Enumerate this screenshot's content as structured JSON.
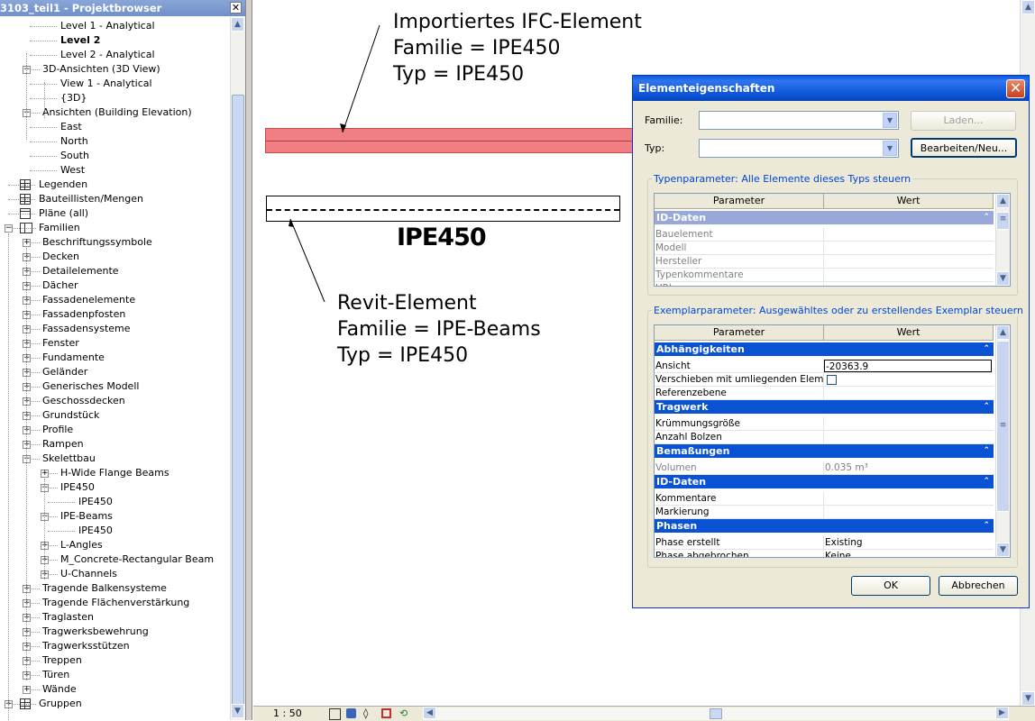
{
  "browser": {
    "title": "3103_teil1 - Projektbrowser",
    "items": [
      {
        "label": "Level 1 - Analytical",
        "indent": 3,
        "bold": false,
        "expander": null,
        "icon": null
      },
      {
        "label": "Level 2",
        "indent": 3,
        "bold": true,
        "expander": null,
        "icon": null
      },
      {
        "label": "Level 2 - Analytical",
        "indent": 3,
        "bold": false,
        "expander": null,
        "icon": null
      },
      {
        "label": "3D-Ansichten (3D View)",
        "indent": 2,
        "bold": false,
        "expander": "-",
        "icon": null
      },
      {
        "label": "View 1 - Analytical",
        "indent": 3,
        "bold": false,
        "expander": null,
        "icon": null
      },
      {
        "label": "{3D}",
        "indent": 3,
        "bold": false,
        "expander": null,
        "icon": null
      },
      {
        "label": "Ansichten (Building Elevation)",
        "indent": 2,
        "bold": false,
        "expander": "-",
        "icon": null
      },
      {
        "label": "East",
        "indent": 3,
        "bold": false,
        "expander": null,
        "icon": null
      },
      {
        "label": "North",
        "indent": 3,
        "bold": false,
        "expander": null,
        "icon": null
      },
      {
        "label": "South",
        "indent": 3,
        "bold": false,
        "expander": null,
        "icon": null
      },
      {
        "label": "West",
        "indent": 3,
        "bold": false,
        "expander": null,
        "icon": null
      },
      {
        "label": "Legenden",
        "indent": 1,
        "bold": false,
        "expander": null,
        "icon": "grid"
      },
      {
        "label": "Bauteillisten/Mengen",
        "indent": 1,
        "bold": false,
        "expander": null,
        "icon": "grid"
      },
      {
        "label": "Pläne (all)",
        "indent": 1,
        "bold": false,
        "expander": null,
        "icon": "sheet"
      },
      {
        "label": "Familien",
        "indent": 1,
        "bold": false,
        "expander": "-",
        "icon": "fam"
      },
      {
        "label": "Beschriftungssymbole",
        "indent": 2,
        "bold": false,
        "expander": "+",
        "icon": null
      },
      {
        "label": "Decken",
        "indent": 2,
        "bold": false,
        "expander": "+",
        "icon": null
      },
      {
        "label": "Detailelemente",
        "indent": 2,
        "bold": false,
        "expander": "+",
        "icon": null
      },
      {
        "label": "Dächer",
        "indent": 2,
        "bold": false,
        "expander": "+",
        "icon": null
      },
      {
        "label": "Fassadenelemente",
        "indent": 2,
        "bold": false,
        "expander": "+",
        "icon": null
      },
      {
        "label": "Fassadenpfosten",
        "indent": 2,
        "bold": false,
        "expander": "+",
        "icon": null
      },
      {
        "label": "Fassadensysteme",
        "indent": 2,
        "bold": false,
        "expander": "+",
        "icon": null
      },
      {
        "label": "Fenster",
        "indent": 2,
        "bold": false,
        "expander": "+",
        "icon": null
      },
      {
        "label": "Fundamente",
        "indent": 2,
        "bold": false,
        "expander": "+",
        "icon": null
      },
      {
        "label": "Geländer",
        "indent": 2,
        "bold": false,
        "expander": "+",
        "icon": null
      },
      {
        "label": "Generisches Modell",
        "indent": 2,
        "bold": false,
        "expander": "+",
        "icon": null
      },
      {
        "label": "Geschossdecken",
        "indent": 2,
        "bold": false,
        "expander": "+",
        "icon": null
      },
      {
        "label": "Grundstück",
        "indent": 2,
        "bold": false,
        "expander": "+",
        "icon": null
      },
      {
        "label": "Profile",
        "indent": 2,
        "bold": false,
        "expander": "+",
        "icon": null
      },
      {
        "label": "Rampen",
        "indent": 2,
        "bold": false,
        "expander": "+",
        "icon": null
      },
      {
        "label": "Skelettbau",
        "indent": 2,
        "bold": false,
        "expander": "-",
        "icon": null
      },
      {
        "label": "H-Wide Flange Beams",
        "indent": 3,
        "bold": false,
        "expander": "+",
        "icon": null
      },
      {
        "label": "IPE450",
        "indent": 3,
        "bold": false,
        "expander": "-",
        "icon": null
      },
      {
        "label": "IPE450",
        "indent": 4,
        "bold": false,
        "expander": null,
        "icon": null
      },
      {
        "label": "IPE-Beams",
        "indent": 3,
        "bold": false,
        "expander": "-",
        "icon": null
      },
      {
        "label": "IPE450",
        "indent": 4,
        "bold": false,
        "expander": null,
        "icon": null
      },
      {
        "label": "L-Angles",
        "indent": 3,
        "bold": false,
        "expander": "+",
        "icon": null
      },
      {
        "label": "M_Concrete-Rectangular Beam",
        "indent": 3,
        "bold": false,
        "expander": "+",
        "icon": null
      },
      {
        "label": "U-Channels",
        "indent": 3,
        "bold": false,
        "expander": "+",
        "icon": null
      },
      {
        "label": "Tragende Balkensysteme",
        "indent": 2,
        "bold": false,
        "expander": "+",
        "icon": null
      },
      {
        "label": "Tragende Flächenverstärkung",
        "indent": 2,
        "bold": false,
        "expander": "+",
        "icon": null
      },
      {
        "label": "Traglasten",
        "indent": 2,
        "bold": false,
        "expander": "+",
        "icon": null
      },
      {
        "label": "Tragwerksbewehrung",
        "indent": 2,
        "bold": false,
        "expander": "+",
        "icon": null
      },
      {
        "label": "Tragwerksstützen",
        "indent": 2,
        "bold": false,
        "expander": "+",
        "icon": null
      },
      {
        "label": "Treppen",
        "indent": 2,
        "bold": false,
        "expander": "+",
        "icon": null
      },
      {
        "label": "Türen",
        "indent": 2,
        "bold": false,
        "expander": "+",
        "icon": null
      },
      {
        "label": "Wände",
        "indent": 2,
        "bold": false,
        "expander": "+",
        "icon": null
      },
      {
        "label": "Gruppen",
        "indent": 1,
        "bold": false,
        "expander": "+",
        "icon": "group"
      }
    ]
  },
  "canvas": {
    "ifc_annotation": [
      "Importiertes IFC-Element",
      "Familie = IPE450",
      "Typ = IPE450"
    ],
    "revit_annotation": [
      "Revit-Element",
      "Familie = IPE-Beams",
      "Typ = IPE450"
    ],
    "beam_tag": "IPE450",
    "ifc_color": "#f07f84"
  },
  "statusbar": {
    "scale": "1 : 50"
  },
  "dialog": {
    "title": "Elementeigenschaften",
    "familie_label": "Familie:",
    "typ_label": "Typ:",
    "familie_value": "",
    "typ_value": "",
    "laden_label": "Laden...",
    "bearbeiten_label": "Bearbeiten/Neu...",
    "type_group_title": "Typenparameter: Alle Elemente dieses Typs steuern",
    "instance_group_title": "Exemplarparameter: Ausgewähltes oder zu erstellendes Exemplar steuern",
    "col_parameter": "Parameter",
    "col_wert": "Wert",
    "type_rows": [
      {
        "kind": "group",
        "label": "ID-Daten"
      },
      {
        "kind": "row",
        "name": "Bauelement",
        "value": ""
      },
      {
        "kind": "row",
        "name": "Modell",
        "value": ""
      },
      {
        "kind": "row",
        "name": "Hersteller",
        "value": ""
      },
      {
        "kind": "row",
        "name": "Typenkommentare",
        "value": ""
      },
      {
        "kind": "row",
        "name": "URL",
        "value": ""
      }
    ],
    "instance_rows": [
      {
        "kind": "group",
        "label": "Abhängigkeiten"
      },
      {
        "kind": "row",
        "name": "Ansicht",
        "value": "-20363.9",
        "edit": true
      },
      {
        "kind": "row",
        "name": "Verschieben mit umliegenden Element",
        "value": "",
        "checkbox": true
      },
      {
        "kind": "row",
        "name": "Referenzebene",
        "value": ""
      },
      {
        "kind": "group",
        "label": "Tragwerk"
      },
      {
        "kind": "row",
        "name": "Krümmungsgröße",
        "value": ""
      },
      {
        "kind": "row",
        "name": "Anzahl Bolzen",
        "value": ""
      },
      {
        "kind": "group",
        "label": "Bemaßungen"
      },
      {
        "kind": "row",
        "name": "Volumen",
        "value": "0.035 m³",
        "readonly": true
      },
      {
        "kind": "group",
        "label": "ID-Daten"
      },
      {
        "kind": "row",
        "name": "Kommentare",
        "value": ""
      },
      {
        "kind": "row",
        "name": "Markierung",
        "value": ""
      },
      {
        "kind": "group",
        "label": "Phasen"
      },
      {
        "kind": "row",
        "name": "Phase erstellt",
        "value": "Existing"
      },
      {
        "kind": "row",
        "name": "Phase abgebrochen",
        "value": "Keine"
      }
    ],
    "ok_label": "OK",
    "cancel_label": "Abbrechen"
  }
}
